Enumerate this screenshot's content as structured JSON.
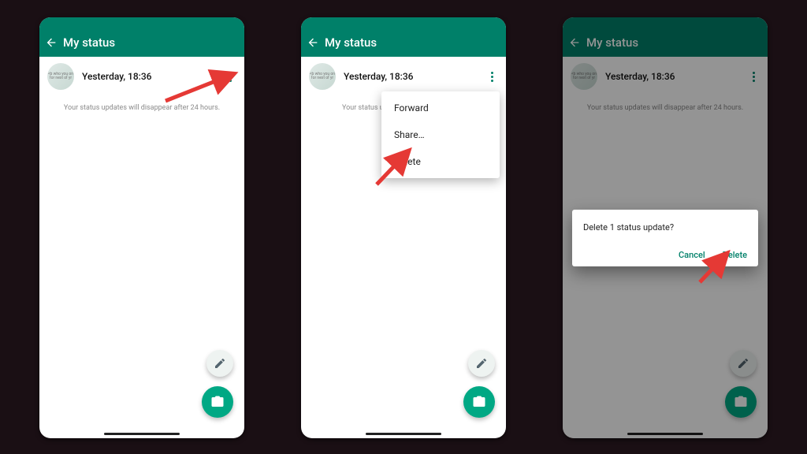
{
  "colors": {
    "brand": "#008069",
    "accent": "#00a884",
    "text_muted": "#8a8a8a"
  },
  "header": {
    "title": "My status"
  },
  "status": {
    "timestamp": "Yesterday, 18:36",
    "thumb_caption": "<b who you on for next of yr"
  },
  "footer_note_full": "Your status updates will disappear after 24 hours.",
  "footer_note_clipped": "Your status updates will d",
  "menu": {
    "items": [
      "Forward",
      "Share…",
      "Delete"
    ]
  },
  "dialog": {
    "message": "Delete 1 status update?",
    "cancel": "Cancel",
    "confirm": "Delete"
  },
  "icons": {
    "back": "arrow-back-icon",
    "kebab": "more-vert-icon",
    "edit": "pencil-icon",
    "camera": "camera-icon"
  }
}
